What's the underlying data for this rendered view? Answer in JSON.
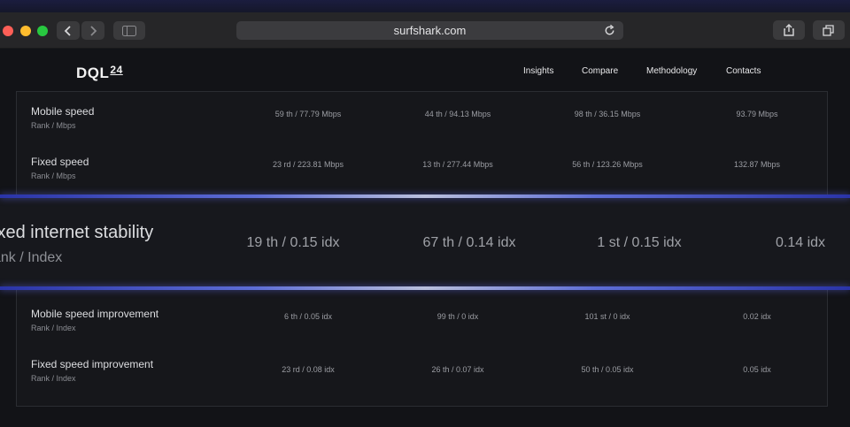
{
  "browser": {
    "url": "surfshark.com"
  },
  "header": {
    "logo": "DQL",
    "logo_sup": "24",
    "nav": [
      "Insights",
      "Compare",
      "Methodology",
      "Contacts"
    ]
  },
  "rows_top": [
    {
      "title": "Mobile speed",
      "subtitle": "Rank  /  Mbps",
      "values": [
        "59 th  /  77.79 Mbps",
        "44 th  /  94.13 Mbps",
        "98 th  /  36.15 Mbps",
        "93.79 Mbps"
      ]
    },
    {
      "title": "Fixed speed",
      "subtitle": "Rank  /  Mbps",
      "values": [
        "23 rd  /  223.81 Mbps",
        "13 th  /  277.44 Mbps",
        "56 th  /  123.26 Mbps",
        "132.87 Mbps"
      ]
    }
  ],
  "zoom_row": {
    "title": "ixed internet stability",
    "subtitle": "ank  /  Index",
    "values": [
      "19 th  /  0.15 idx",
      "67 th  /  0.14 idx",
      "1 st  /  0.15 idx",
      "0.14 idx"
    ]
  },
  "rows_bottom": [
    {
      "title": "Mobile speed improvement",
      "subtitle": "Rank  /  Index",
      "values": [
        "6 th  /  0.05 idx",
        "99 th  /  0 idx",
        "101 st  /  0 idx",
        "0.02 idx"
      ]
    },
    {
      "title": "Fixed speed improvement",
      "subtitle": "Rank  /  Index",
      "values": [
        "23 rd  /  0.08 idx",
        "26 th  /  0.07 idx",
        "50 th  /  0.05 idx",
        "0.05 idx"
      ]
    }
  ]
}
